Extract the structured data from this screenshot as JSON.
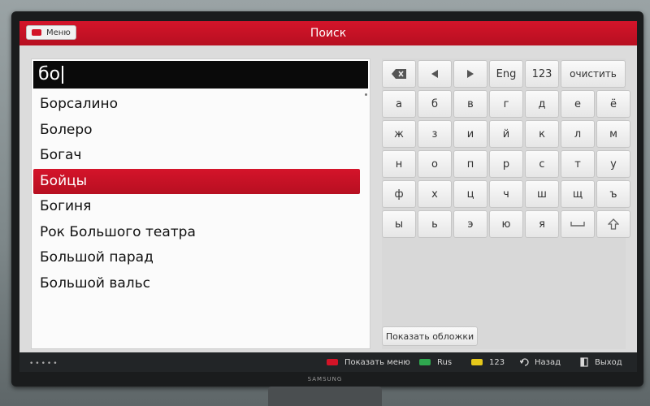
{
  "header": {
    "menu_label": "Меню",
    "title": "Поиск"
  },
  "search": {
    "query": "бо"
  },
  "results": [
    "Борсалино",
    "Болеро",
    "Богач",
    "Бойцы",
    "Богиня",
    "Рок Большого театра",
    "Большой парад",
    "Большой вальс"
  ],
  "selected_result": "Бойцы",
  "keyboard": {
    "controls": {
      "backspace_icon": "backspace-icon",
      "left_icon": "arrow-left-icon",
      "right_icon": "arrow-right-icon",
      "eng": "Eng",
      "num": "123",
      "clear": "очистить"
    },
    "rows": [
      [
        "а",
        "б",
        "в",
        "г",
        "д",
        "е",
        "ё"
      ],
      [
        "ж",
        "з",
        "и",
        "й",
        "к",
        "л",
        "м"
      ],
      [
        "н",
        "о",
        "п",
        "р",
        "с",
        "т",
        "у"
      ],
      [
        "ф",
        "х",
        "ц",
        "ч",
        "ш",
        "щ",
        "ъ"
      ],
      [
        "ы",
        "ь",
        "э",
        "ю",
        "я"
      ]
    ],
    "space_icon": "space-icon",
    "shift_icon": "shift-icon"
  },
  "cover_button": "Показать обложки",
  "footer": {
    "show_menu": "Показать меню",
    "rus": "Rus",
    "num": "123",
    "back": "Назад",
    "exit": "Выход",
    "colors": {
      "red": "#d31427",
      "green": "#2fa84f",
      "yellow": "#e5c81a"
    }
  },
  "brand": "SAMSUNG",
  "colors": {
    "accent": "#c8122a",
    "selected": "#c8122a",
    "query_bg": "#0a0a0a"
  }
}
